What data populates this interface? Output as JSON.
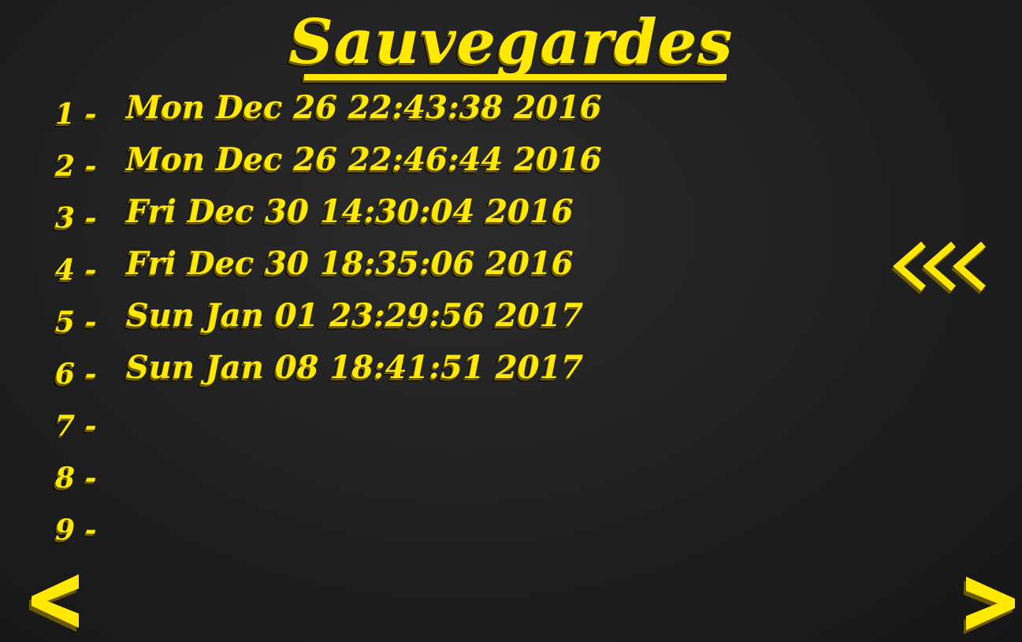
{
  "screen": {
    "title": "Sauvegardes"
  },
  "saves": [
    {
      "number": "1 -",
      "date": "Mon Dec 26 22:43:38 2016"
    },
    {
      "number": "2 -",
      "date": "Mon Dec 26 22:46:44 2016"
    },
    {
      "number": "3 -",
      "date": "Fri Dec 30 14:30:04 2016"
    },
    {
      "number": "4 -",
      "date": "Fri Dec 30 18:35:06 2016"
    },
    {
      "number": "5 -",
      "date": "Sun Jan 01 23:29:56 2017"
    },
    {
      "number": "6 -",
      "date": "Sun Jan 08 18:41:51 2017"
    },
    {
      "number": "7 -",
      "date": ""
    },
    {
      "number": "8 -",
      "date": ""
    },
    {
      "number": "9 -",
      "date": ""
    }
  ],
  "navigation": {
    "back_icon": "triple-chevron-left-icon",
    "prev_icon": "chevron-left-icon",
    "next_icon": "chevron-right-icon"
  },
  "colors": {
    "accent": "#ffe900",
    "shadow": "#6b5a00",
    "background": "#222222"
  }
}
